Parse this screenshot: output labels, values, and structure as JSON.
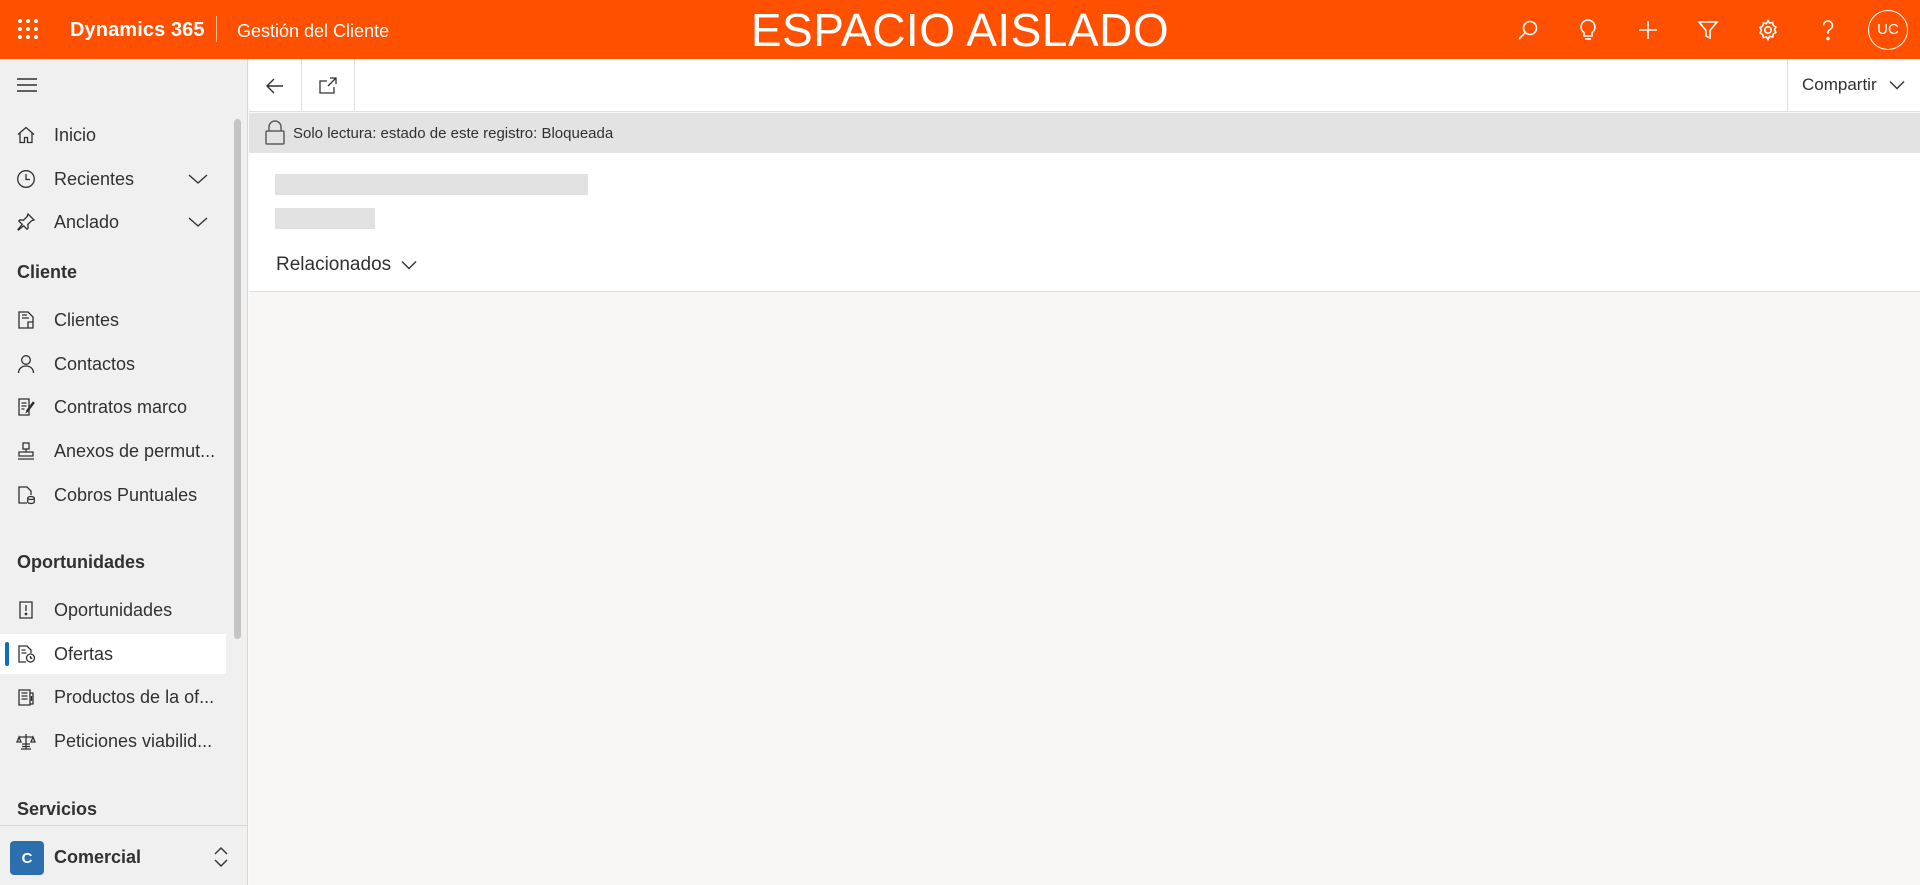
{
  "colors": {
    "brand_bar": "#ff5000",
    "sidebar_bg": "#f0f0f0",
    "active_indicator": "#0f6cbd",
    "area_badge": "#2c6fae"
  },
  "topbar": {
    "app_name": "Dynamics 365",
    "module_name": "Gestión del Cliente",
    "environment_title": "ESPACIO AISLADO",
    "icons": [
      "waffle-icon",
      "search-icon",
      "lightbulb-icon",
      "plus-icon",
      "filter-icon",
      "gear-icon",
      "help-icon"
    ],
    "avatar_initials": "UC"
  },
  "sidebar": {
    "top_items": [
      {
        "label": "Inicio",
        "icon": "home-icon"
      },
      {
        "label": "Recientes",
        "icon": "clock-icon"
      },
      {
        "label": "Anclado",
        "icon": "pin-icon"
      }
    ],
    "groups": [
      {
        "label": "Cliente",
        "items": [
          {
            "label": "Clientes",
            "icon": "account-icon"
          },
          {
            "label": "Contactos",
            "icon": "person-icon"
          },
          {
            "label": "Contratos marco",
            "icon": "contract-icon"
          },
          {
            "label": "Anexos de permut...",
            "icon": "stamp-icon"
          },
          {
            "label": "Cobros Puntuales",
            "icon": "document-coins-icon"
          }
        ]
      },
      {
        "label": "Oportunidades",
        "items": [
          {
            "label": "Oportunidades",
            "icon": "opportunity-icon"
          },
          {
            "label": "Ofertas",
            "icon": "quote-icon",
            "active": true
          },
          {
            "label": "Productos de la of...",
            "icon": "products-icon"
          },
          {
            "label": "Peticiones viabilid...",
            "icon": "scales-icon"
          }
        ]
      },
      {
        "label": "Servicios",
        "items": []
      }
    ],
    "area": {
      "badge": "C",
      "label": "Comercial"
    }
  },
  "commandbar": {
    "share_label": "Compartir"
  },
  "readonly": {
    "text": "Solo lectura: estado de este registro: Bloqueada"
  },
  "header": {
    "related_label": "Relacionados"
  }
}
